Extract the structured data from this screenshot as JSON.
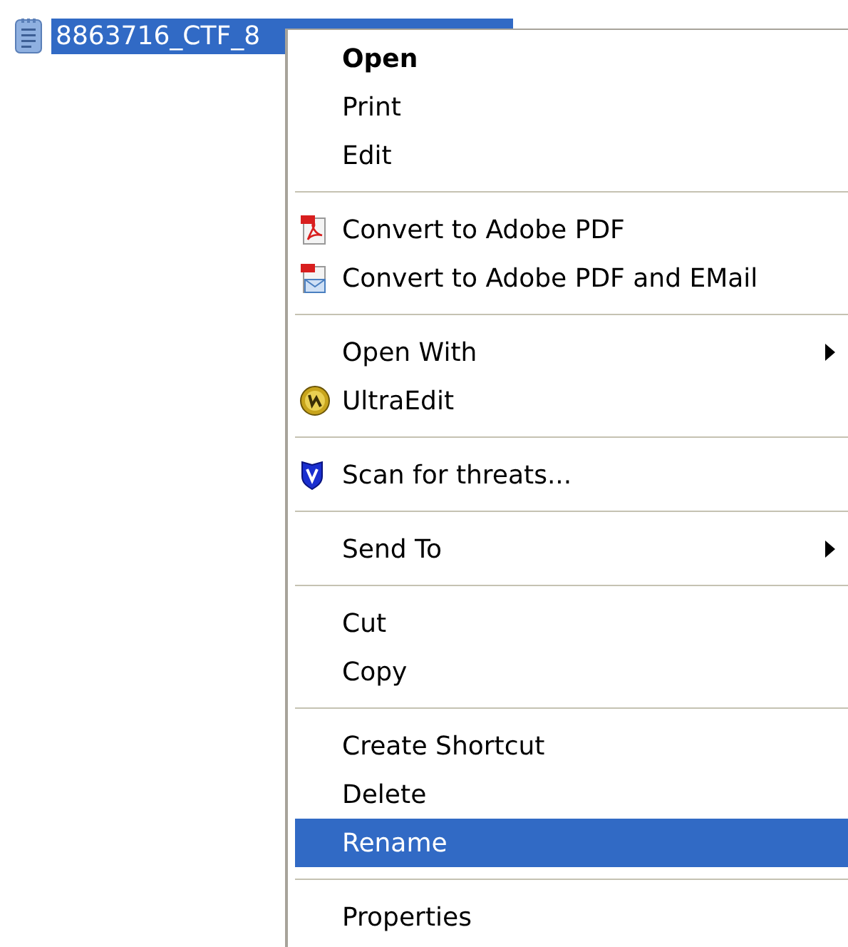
{
  "file": {
    "name": "8863716_CTF_8",
    "selected": true
  },
  "menu": {
    "items": [
      {
        "kind": "item",
        "label": "Open",
        "default": true,
        "submenu": false,
        "selected": false
      },
      {
        "kind": "item",
        "label": "Print",
        "default": false,
        "submenu": false,
        "selected": false
      },
      {
        "kind": "item",
        "label": "Edit",
        "default": false,
        "submenu": false,
        "selected": false
      },
      {
        "kind": "separator"
      },
      {
        "kind": "item",
        "label": "Convert to Adobe PDF",
        "default": false,
        "submenu": false,
        "selected": false
      },
      {
        "kind": "item",
        "label": "Convert to Adobe PDF and EMail",
        "default": false,
        "submenu": false,
        "selected": false
      },
      {
        "kind": "separator"
      },
      {
        "kind": "item",
        "label": "Open With",
        "default": false,
        "submenu": true,
        "selected": false
      },
      {
        "kind": "item",
        "label": "UltraEdit",
        "default": false,
        "submenu": false,
        "selected": false
      },
      {
        "kind": "separator"
      },
      {
        "kind": "item",
        "label": "Scan for threats...",
        "default": false,
        "submenu": false,
        "selected": false
      },
      {
        "kind": "separator"
      },
      {
        "kind": "item",
        "label": "Send To",
        "default": false,
        "submenu": true,
        "selected": false
      },
      {
        "kind": "separator"
      },
      {
        "kind": "item",
        "label": "Cut",
        "default": false,
        "submenu": false,
        "selected": false
      },
      {
        "kind": "item",
        "label": "Copy",
        "default": false,
        "submenu": false,
        "selected": false
      },
      {
        "kind": "separator"
      },
      {
        "kind": "item",
        "label": "Create Shortcut",
        "default": false,
        "submenu": false,
        "selected": false
      },
      {
        "kind": "item",
        "label": "Delete",
        "default": false,
        "submenu": false,
        "selected": false
      },
      {
        "kind": "item",
        "label": "Rename",
        "default": false,
        "submenu": false,
        "selected": true
      },
      {
        "kind": "separator"
      },
      {
        "kind": "item",
        "label": "Properties",
        "default": false,
        "submenu": false,
        "selected": false
      }
    ]
  }
}
